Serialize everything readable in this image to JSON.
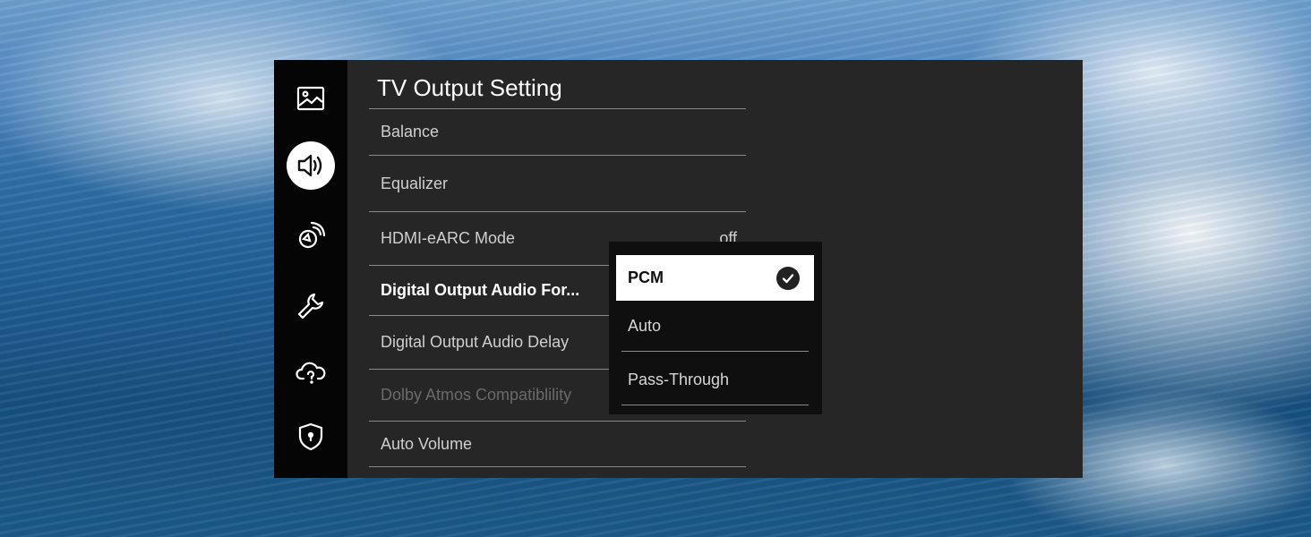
{
  "page": {
    "title": "TV Output Setting"
  },
  "sidebar": {
    "items": [
      {
        "icon": "picture-icon",
        "active": false
      },
      {
        "icon": "speaker-icon",
        "active": true
      },
      {
        "icon": "broadcast-icon",
        "active": false
      },
      {
        "icon": "wrench-icon",
        "active": false
      },
      {
        "icon": "cloud-help-icon",
        "active": false
      },
      {
        "icon": "shield-icon",
        "active": false
      }
    ]
  },
  "menu": {
    "items": [
      {
        "label": "Balance",
        "value": ""
      },
      {
        "label": "Equalizer",
        "value": ""
      },
      {
        "label": "HDMI-eARC Mode",
        "value": "off"
      },
      {
        "label": "Digital Output Audio For...",
        "value": "",
        "state": "selected"
      },
      {
        "label": "Digital Output Audio Delay",
        "value": ""
      },
      {
        "label": "Dolby Atmos Compatiblility",
        "value": "",
        "state": "disabled"
      },
      {
        "label": "Auto Volume",
        "value": ""
      }
    ]
  },
  "dropdown": {
    "options": [
      {
        "label": "PCM",
        "selected": true
      },
      {
        "label": "Auto",
        "selected": false
      },
      {
        "label": "Pass-Through",
        "selected": false
      }
    ]
  },
  "colors": {
    "panel_bg": "#262626",
    "rail_bg": "#050505",
    "dropdown_bg": "#0f0f0f",
    "selected_option_bg": "#ffffff"
  }
}
